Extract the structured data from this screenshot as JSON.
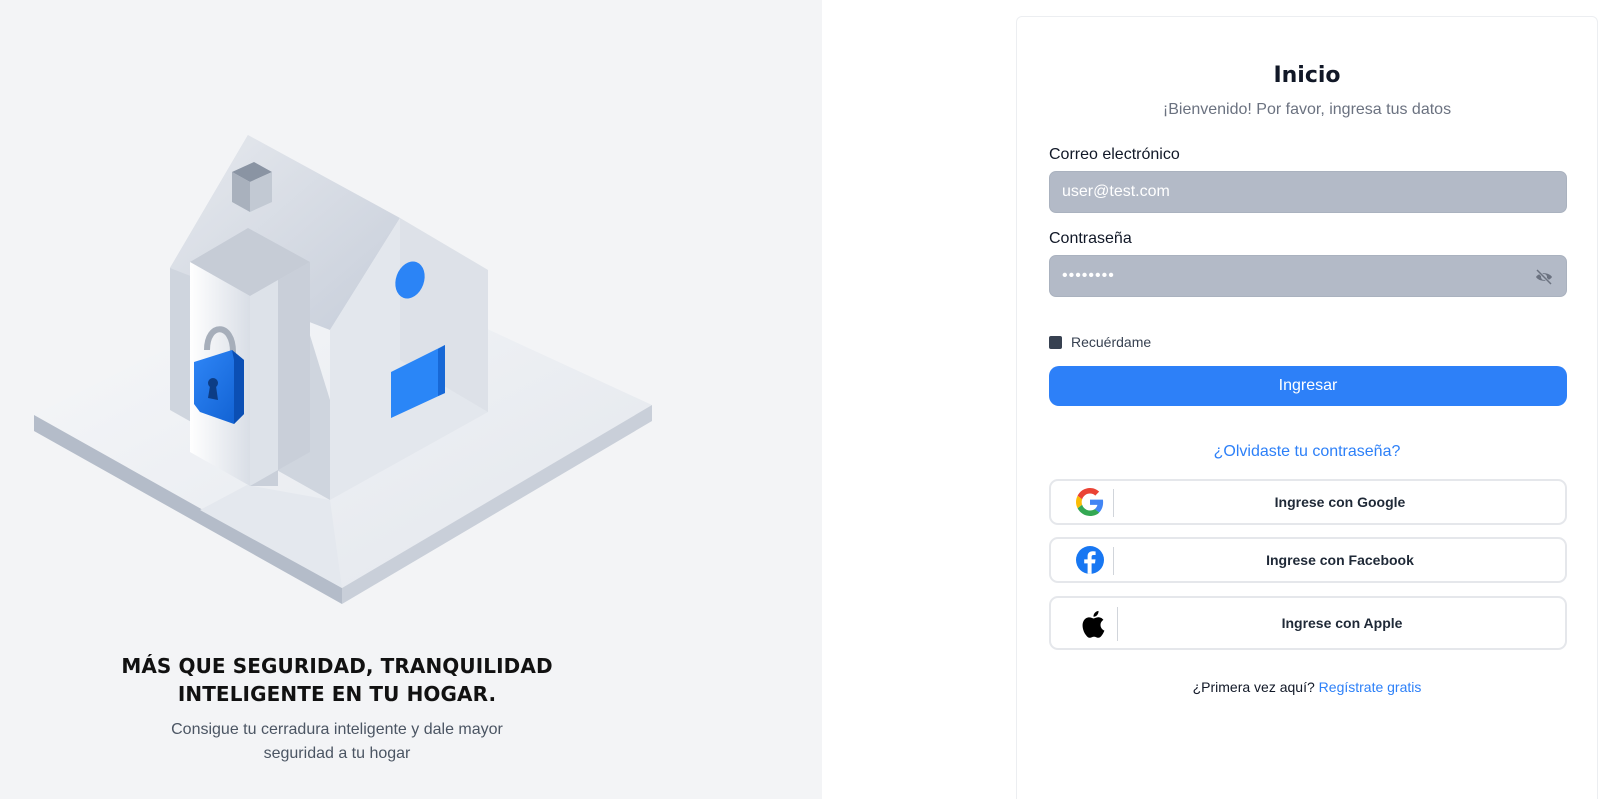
{
  "hero": {
    "title": "MÁS QUE SEGURIDAD, TRANQUILIDAD\nINTELIGENTE EN TU HOGAR.",
    "subtitle": "Consigue tu cerradura inteligente y dale mayor seguridad a tu hogar"
  },
  "login": {
    "title": "Inicio",
    "subtitle": "¡Bienvenido! Por favor, ingresa tus datos",
    "email_label": "Correo electrónico",
    "email_value": "user@test.com",
    "password_label": "Contraseña",
    "password_value": "••••••••",
    "remember_label": "Recuérdame",
    "submit_label": "Ingresar",
    "forgot_label": "¿Olvidaste tu contraseña?"
  },
  "social": {
    "google_label": "Ingrese con Google",
    "facebook_label": "Ingrese con Facebook",
    "apple_label": "Ingrese con Apple"
  },
  "register": {
    "prompt": "¿Primera vez aquí?",
    "link": "Regístrate gratis"
  },
  "colors": {
    "accent": "#2d80f8",
    "input_bg": "#b3bac7",
    "left_bg": "#f3f4f6"
  },
  "icons": [
    "house-lock-illustration",
    "eye-off-icon",
    "google-icon",
    "facebook-icon",
    "apple-icon"
  ]
}
